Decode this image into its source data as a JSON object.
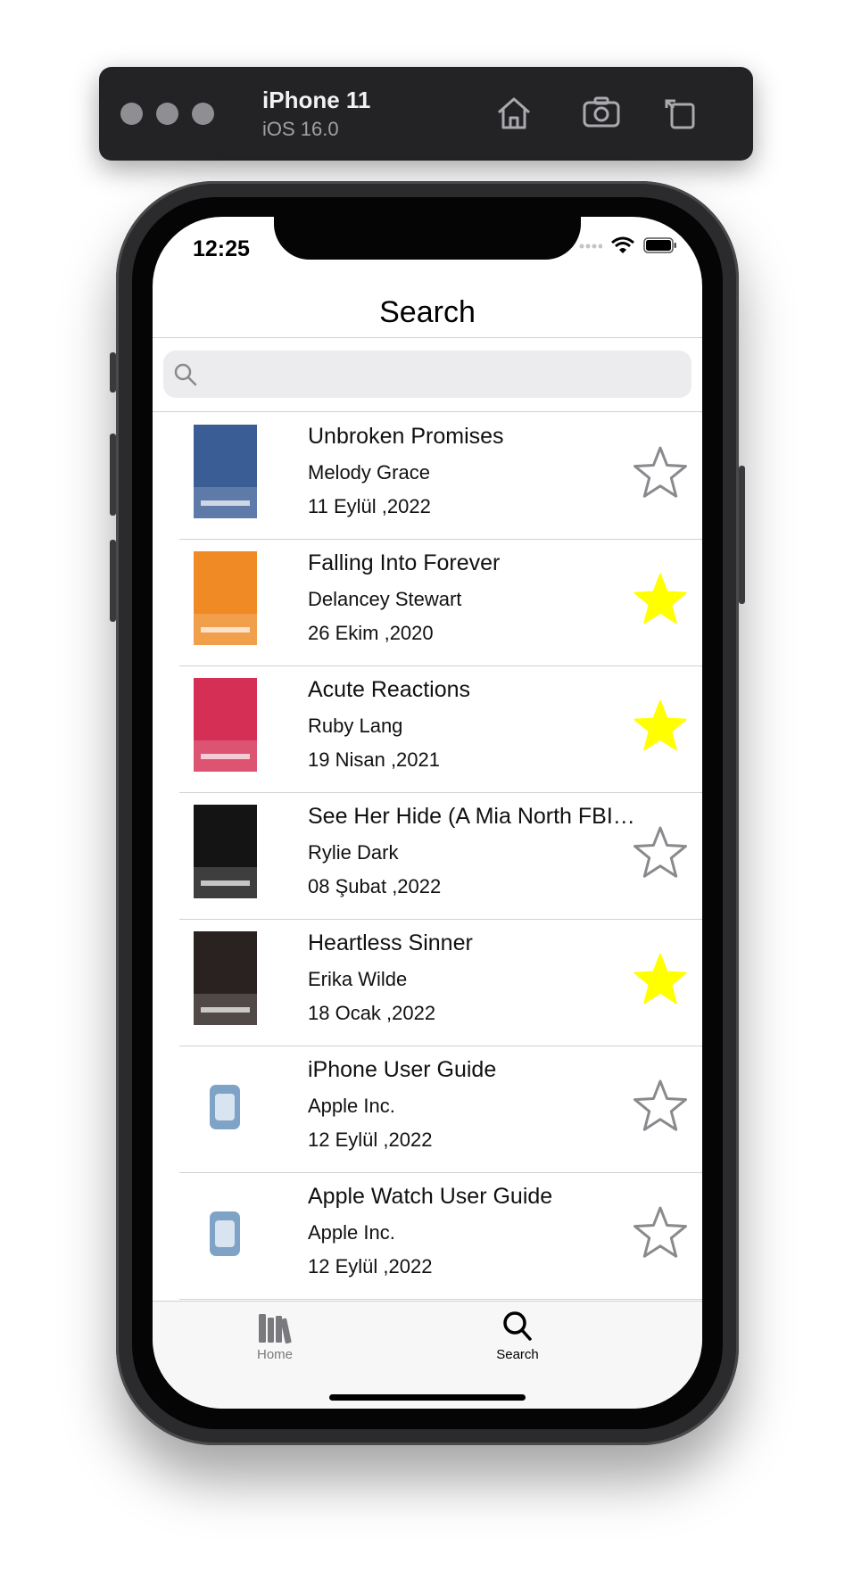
{
  "simulator": {
    "device_name": "iPhone 11",
    "os_version": "iOS 16.0",
    "icons": [
      "home-icon",
      "screenshot-icon",
      "rotate-icon"
    ]
  },
  "status_bar": {
    "time": "12:25"
  },
  "nav": {
    "title": "Search"
  },
  "search": {
    "placeholder": "",
    "value": ""
  },
  "books": [
    {
      "title": "Unbroken Promises",
      "author": "Melody Grace",
      "date": "11 Eylül ,2022",
      "favorite": false,
      "cover_color": "#3b5d96"
    },
    {
      "title": "Falling Into Forever",
      "author": "Delancey Stewart",
      "date": "26 Ekim ,2020",
      "favorite": true,
      "cover_color": "#f08a24"
    },
    {
      "title": "Acute Reactions",
      "author": "Ruby Lang",
      "date": "19 Nisan ,2021",
      "favorite": true,
      "cover_color": "#d62f55"
    },
    {
      "title": "See Her Hide (A Mia North FBI…",
      "author": "Rylie Dark",
      "date": "08 Şubat ,2022",
      "favorite": false,
      "cover_color": "#141414"
    },
    {
      "title": "Heartless Sinner",
      "author": "Erika Wilde",
      "date": "18 Ocak ,2022",
      "favorite": true,
      "cover_color": "#2a2220"
    },
    {
      "title": "iPhone User Guide",
      "author": "Apple Inc.",
      "date": "12 Eylül ,2022",
      "favorite": false,
      "cover_color": "#ffffff"
    },
    {
      "title": "Apple Watch User Guide",
      "author": "Apple Inc.",
      "date": "12 Eylül ,2022",
      "favorite": false,
      "cover_color": "#ffffff"
    }
  ],
  "tabs": [
    {
      "label": "Home",
      "icon": "books-icon",
      "selected": false
    },
    {
      "label": "Search",
      "icon": "magnifier-icon",
      "selected": true
    }
  ],
  "colors": {
    "star_filled": "#ffff00",
    "star_empty": "#8a8a8e",
    "tab_selected": "#000000",
    "tab_unselected": "#7a7a7e"
  }
}
